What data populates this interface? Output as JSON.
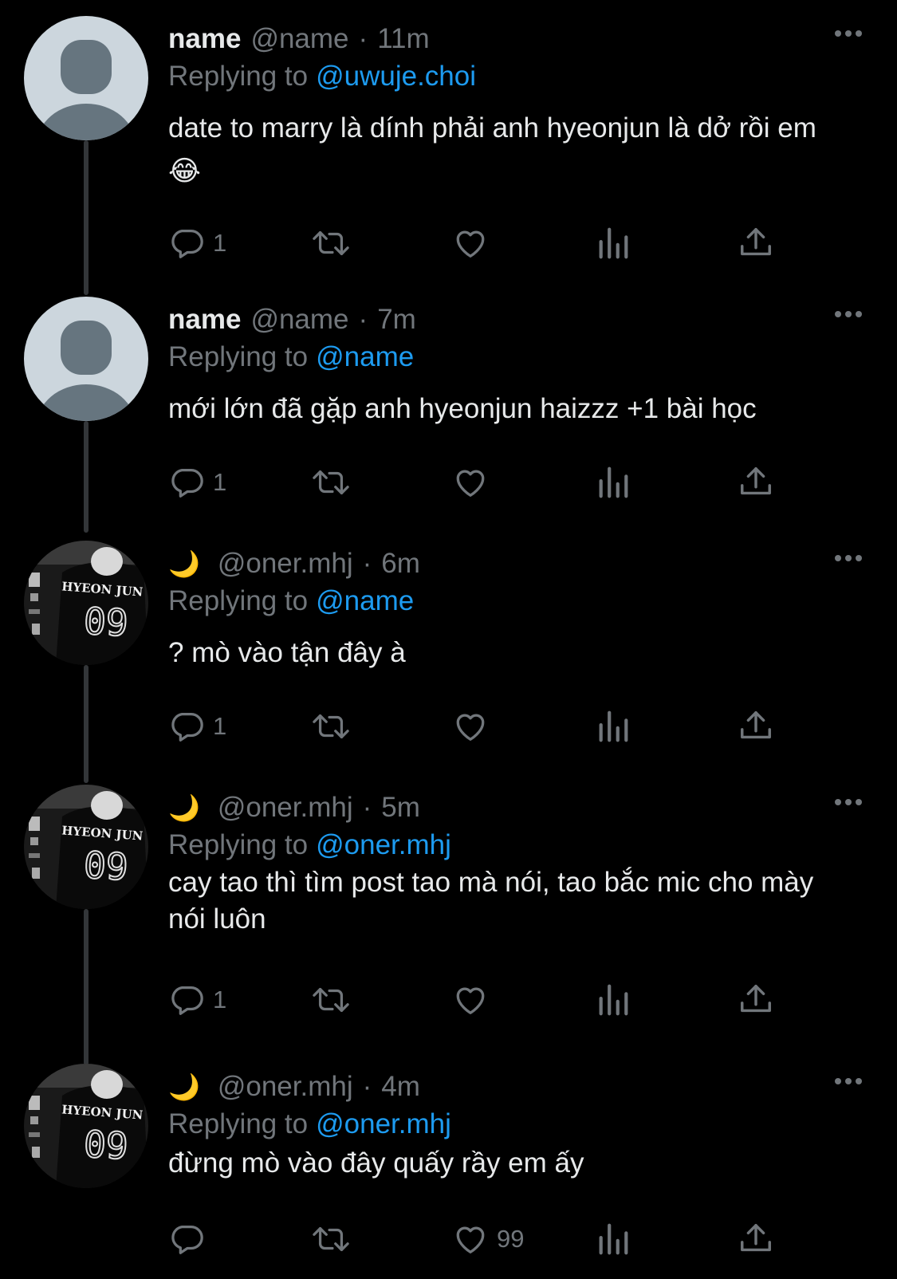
{
  "tweets": [
    {
      "display_name": "name",
      "handle": "@name",
      "separator": "·",
      "time": "11m",
      "reply_prefix": "Replying to",
      "reply_to": "@uwuje.choi",
      "text": "date to marry là dính phải anh hyeonjun là dở rồi em 😂",
      "reply_count": "1",
      "like_count": "",
      "avatar": "default-avatar"
    },
    {
      "display_name": "name",
      "handle": "@name",
      "separator": "·",
      "time": "7m",
      "reply_prefix": "Replying to",
      "reply_to": "@name",
      "text": "mới lớn đã gặp anh hyeonjun haizzz +1 bài học",
      "reply_count": "1",
      "like_count": "",
      "avatar": "default-avatar"
    },
    {
      "display_name": "🌙",
      "handle": "@oner.mhj",
      "separator": "·",
      "time": "6m",
      "reply_prefix": "Replying to",
      "reply_to": "@name",
      "text": "? mò vào tận đây à",
      "reply_count": "1",
      "like_count": "",
      "avatar": "jersey-photo"
    },
    {
      "display_name": "🌙",
      "handle": "@oner.mhj",
      "separator": "·",
      "time": "5m",
      "reply_prefix": "Replying to",
      "reply_to": "@oner.mhj",
      "text": "cay tao thì tìm post tao mà nói, tao bắc mic cho mày nói luôn",
      "reply_count": "1",
      "like_count": "",
      "avatar": "jersey-photo"
    },
    {
      "display_name": "🌙",
      "handle": "@oner.mhj",
      "separator": "·",
      "time": "4m",
      "reply_prefix": "Replying to",
      "reply_to": "@oner.mhj",
      "text": "đừng mò vào đây quấy rầy em ấy",
      "reply_count": "",
      "like_count": "99",
      "avatar": "jersey-photo"
    }
  ],
  "jersey": {
    "name": "HYEON JUN",
    "number": "09"
  },
  "colors": {
    "background": "#000000",
    "text": "#e7e9ea",
    "muted": "#71767b",
    "link": "#1d9bf0",
    "thread_line": "#333639"
  },
  "icons": [
    "reply-icon",
    "retweet-icon",
    "like-icon",
    "views-icon",
    "share-icon",
    "more-icon"
  ]
}
